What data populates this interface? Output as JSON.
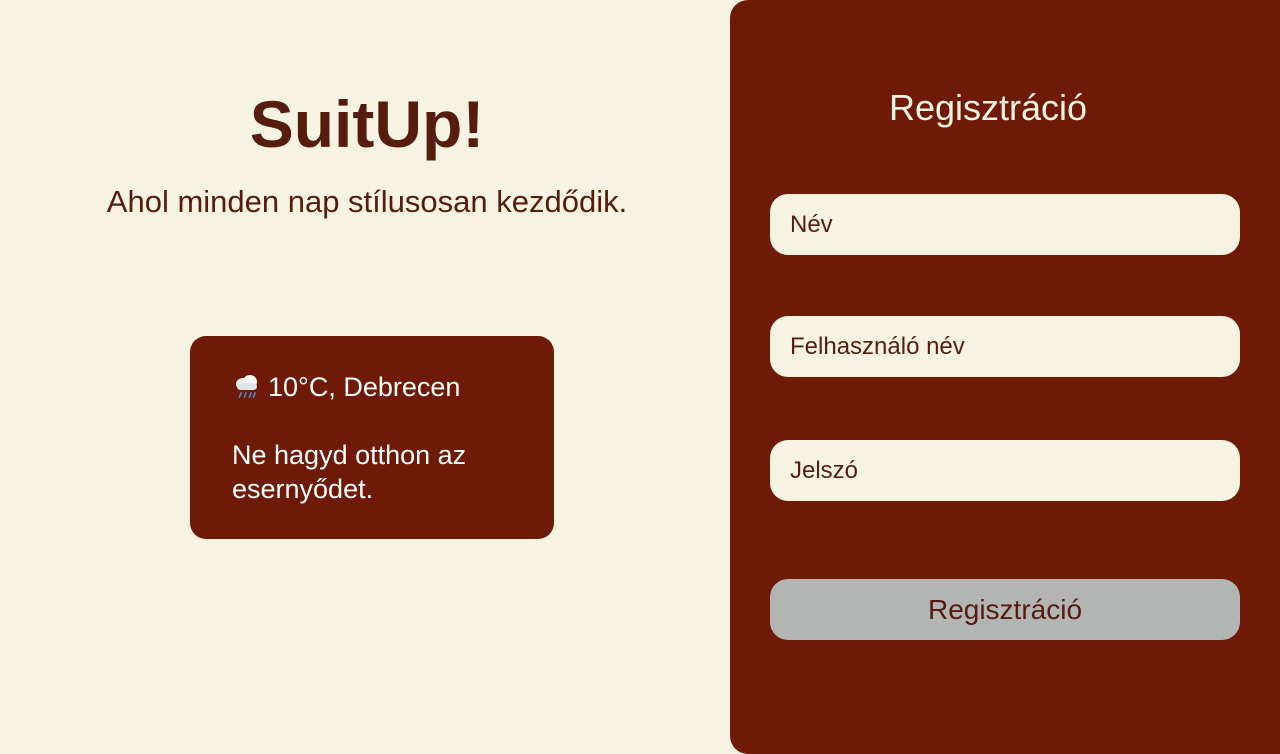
{
  "brand": {
    "title": "SuitUp!",
    "tagline": "Ahol minden nap stílusosan kezdődik."
  },
  "weather": {
    "icon": "rain-cloud-icon",
    "summary": "10°C, Debrecen",
    "advice": "Ne hagyd otthon az esernyődet."
  },
  "registration": {
    "title": "Regisztráció",
    "fields": {
      "name_placeholder": "Név",
      "username_placeholder": "Felhasználó név",
      "password_placeholder": "Jelszó"
    },
    "submit_label": "Regisztráció"
  },
  "colors": {
    "background": "#f7f3e3",
    "panel": "#6f1a06",
    "text_dark": "#561c0e",
    "button_disabled": "#b3b5b5"
  }
}
